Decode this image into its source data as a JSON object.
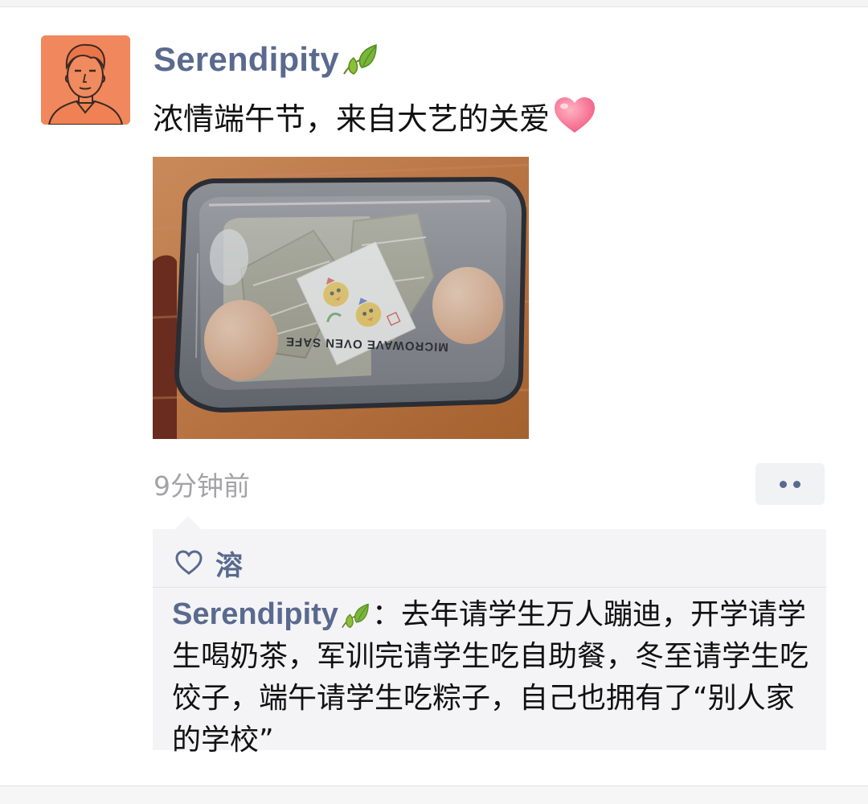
{
  "post": {
    "username": "Serendipity",
    "name_icon": "leaf-icon",
    "text": "浓情端午节，来自大艺的关爱",
    "emoji": "heart-icon",
    "photo_label": "MICROWAVE OVEN SAFE",
    "time": "9分钟前"
  },
  "likes": {
    "icon": "heart-outline-icon",
    "names": "溶"
  },
  "comments": [
    {
      "author": "Serendipity",
      "separator": "：",
      "text": "去年请学生万人蹦迪，开学请学生喝奶茶，军训完请学生吃自助餐，冬至请学生吃饺子，端午请学生吃粽子，自己也拥有了“别人家的学校”"
    }
  ],
  "colors": {
    "name_blue": "#5a6a8e",
    "timestamp_gray": "#a3a3a8",
    "comment_bg": "#f4f4f6",
    "avatar_orange": "#f0875d"
  }
}
